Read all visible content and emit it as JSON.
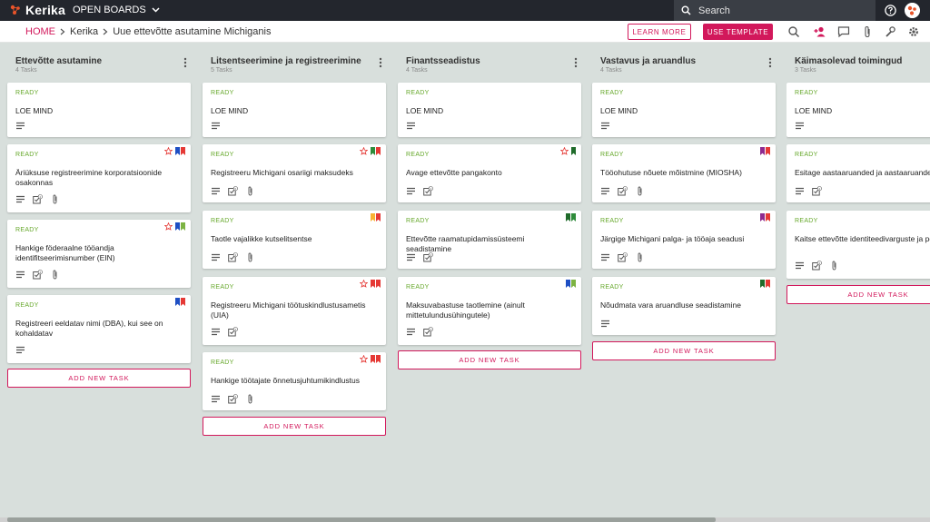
{
  "topbar": {
    "logo_text": "Kerika",
    "open_boards_label": "OPEN BOARDS",
    "search_placeholder": "Search"
  },
  "breadcrumb": {
    "home": "HOME",
    "section": "Kerika",
    "board": "Uue ettevõtte asutamine Michiganis"
  },
  "header_buttons": {
    "learn_more": "LEARN MORE",
    "use_template": "USE TEMPLATE"
  },
  "colors": {
    "accent": "#d2185b",
    "ready": "#66a82b",
    "flag_red": "#e53935",
    "flag_blue": "#1e4fc4",
    "flag_green": "#2e8b3a",
    "flag_darkgreen": "#1f6b2a",
    "flag_lime": "#7cb342",
    "flag_yellow": "#f9b233",
    "flag_purple": "#8e2a8e"
  },
  "add_task_label": "ADD NEW TASK",
  "columns": [
    {
      "title": "Ettevõtte asutamine",
      "count": "4 Tasks",
      "cards": [
        {
          "status": "READY",
          "title": "LOE MIND",
          "flags": [],
          "star": false,
          "icons": [
            "desc"
          ],
          "count": ""
        },
        {
          "status": "READY",
          "title": "Äriüksuse registreerimine korporatsioonide osakonnas",
          "flags": [
            "blue",
            "red"
          ],
          "star": true,
          "icons": [
            "desc",
            "check",
            "clip"
          ],
          "count": "2"
        },
        {
          "status": "READY",
          "title": "Hankige föderaalne tööandja identifitseerimisnumber (EIN)",
          "flags": [
            "blue",
            "lime"
          ],
          "star": true,
          "icons": [
            "desc",
            "check",
            "clip"
          ],
          "count": "4"
        },
        {
          "status": "READY",
          "title": "Registreeri eeldatav nimi (DBA), kui see on kohaldatav",
          "flags": [
            "blue",
            "red"
          ],
          "star": false,
          "icons": [
            "desc"
          ],
          "count": ""
        }
      ]
    },
    {
      "title": "Litsentseerimine ja registreerimine",
      "count": "5 Tasks",
      "cards": [
        {
          "status": "READY",
          "title": "LOE MIND",
          "flags": [],
          "star": false,
          "icons": [
            "desc"
          ],
          "count": ""
        },
        {
          "status": "READY",
          "title": "Registreeru Michigani osariigi maksudeks",
          "flags": [
            "green",
            "red"
          ],
          "star": true,
          "icons": [
            "desc",
            "check",
            "clip"
          ],
          "count": "5"
        },
        {
          "status": "READY",
          "title": "Taotle vajalikke kutselitsentse",
          "flags": [
            "yellow",
            "red"
          ],
          "star": false,
          "icons": [
            "desc",
            "check",
            "clip"
          ],
          "count": "4"
        },
        {
          "status": "READY",
          "title": "Registreeru Michigani töötuskindlustusametis (UIA)",
          "flags": [
            "red",
            "red"
          ],
          "star": true,
          "icons": [
            "desc",
            "check"
          ],
          "count": "4"
        },
        {
          "status": "READY",
          "title": "Hankige töötajate õnnetusjuhtumikindlustus",
          "flags": [
            "red",
            "red"
          ],
          "star": true,
          "icons": [
            "desc",
            "check",
            "clip"
          ],
          "count": "4"
        }
      ]
    },
    {
      "title": "Finantsseadistus",
      "count": "4 Tasks",
      "cards": [
        {
          "status": "READY",
          "title": "LOE MIND",
          "flags": [],
          "star": false,
          "icons": [
            "desc"
          ],
          "count": ""
        },
        {
          "status": "READY",
          "title": "Avage ettevõtte pangakonto",
          "flags": [
            "darkgreen"
          ],
          "star": true,
          "icons": [
            "desc",
            "check"
          ],
          "count": "4"
        },
        {
          "status": "READY",
          "title": "Ettevõtte raamatupidamissüsteemi seadistamine",
          "flags": [
            "darkgreen",
            "green"
          ],
          "star": false,
          "icons": [
            "desc",
            "check"
          ],
          "count": "4"
        },
        {
          "status": "READY",
          "title": "Maksuvabastuse taotlemine (ainult mittetulundusühingutele)",
          "flags": [
            "blue",
            "lime"
          ],
          "star": false,
          "icons": [
            "desc",
            "check"
          ],
          "count": "4"
        }
      ]
    },
    {
      "title": "Vastavus ja aruandlus",
      "count": "4 Tasks",
      "cards": [
        {
          "status": "READY",
          "title": "LOE MIND",
          "flags": [],
          "star": false,
          "icons": [
            "desc"
          ],
          "count": ""
        },
        {
          "status": "READY",
          "title": "Tööohutuse nõuete mõistmine (MIOSHA)",
          "flags": [
            "purple",
            "red"
          ],
          "star": false,
          "icons": [
            "desc",
            "check",
            "clip"
          ],
          "count": "4"
        },
        {
          "status": "READY",
          "title": "Järgige Michigani palga- ja tööaja seadusi",
          "flags": [
            "purple",
            "red"
          ],
          "star": false,
          "icons": [
            "desc",
            "check",
            "clip"
          ],
          "count": "4"
        },
        {
          "status": "READY",
          "title": "Nõudmata vara aruandluse seadistamine",
          "flags": [
            "darkgreen",
            "red"
          ],
          "star": false,
          "icons": [
            "desc"
          ],
          "count": ""
        }
      ]
    },
    {
      "title": "Käimasolevad toimingud",
      "count": "3 Tasks",
      "cards": [
        {
          "status": "READY",
          "title": "LOE MIND",
          "flags": [],
          "star": false,
          "icons": [
            "desc"
          ],
          "count": ""
        },
        {
          "status": "READY",
          "title": "Esitage aastaaruanded ja aastaaruanded",
          "flags": [],
          "star": false,
          "icons": [
            "desc",
            "check"
          ],
          "count": "4"
        },
        {
          "status": "READY",
          "title": "Kaitse ettevõtte identiteedivarguste ja pettuste eest",
          "flags": [],
          "star": false,
          "icons": [
            "desc",
            "check",
            "clip"
          ],
          "count": "4"
        }
      ]
    }
  ]
}
